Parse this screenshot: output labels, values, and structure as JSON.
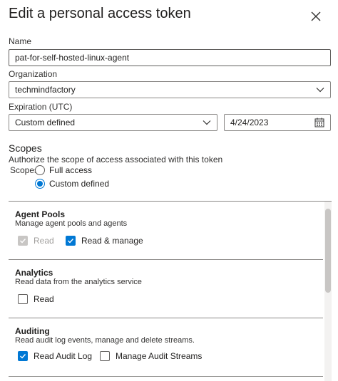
{
  "dialog": {
    "title": "Edit a personal access token"
  },
  "name_field": {
    "label": "Name",
    "value": "pat-for-self-hosted-linux-agent"
  },
  "organization": {
    "label": "Organization",
    "selected": "techmindfactory"
  },
  "expiration": {
    "label": "Expiration (UTC)",
    "selected": "Custom defined",
    "date": "4/24/2023"
  },
  "scopes": {
    "title": "Scopes",
    "subtitle": "Authorize the scope of access associated with this token",
    "label": "Scopes",
    "options": [
      {
        "label": "Full access",
        "selected": false
      },
      {
        "label": "Custom defined",
        "selected": true
      }
    ]
  },
  "scope_groups": [
    {
      "title": "Agent Pools",
      "description": "Manage agent pools and agents",
      "checkboxes": [
        {
          "label": "Read",
          "checked": true,
          "disabled": true
        },
        {
          "label": "Read & manage",
          "checked": true,
          "disabled": false
        }
      ]
    },
    {
      "title": "Analytics",
      "description": "Read data from the analytics service",
      "checkboxes": [
        {
          "label": "Read",
          "checked": false,
          "disabled": false
        }
      ]
    },
    {
      "title": "Auditing",
      "description": "Read audit log events, manage and delete streams.",
      "checkboxes": [
        {
          "label": "Read Audit Log",
          "checked": true,
          "disabled": false
        },
        {
          "label": "Manage Audit Streams",
          "checked": false,
          "disabled": false
        }
      ]
    }
  ],
  "colors": {
    "accent": "#0078d4",
    "border": "#8a8886",
    "disabled": "#c8c6c4"
  }
}
